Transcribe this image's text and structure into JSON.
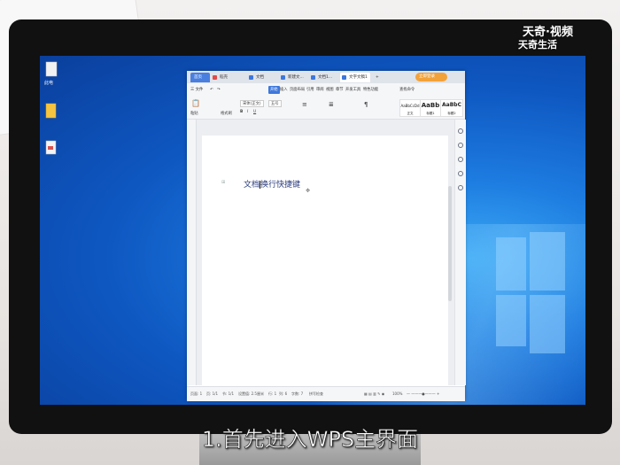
{
  "watermark": {
    "line1": "天奇·视频",
    "line2": "天奇生活"
  },
  "caption": "1.首先进入WPS主界面",
  "desktop": {
    "icons": [
      {
        "name": "file-icon",
        "label": "此电"
      },
      {
        "name": "folder-icon",
        "label": ""
      },
      {
        "name": "doc-icon",
        "label": ""
      }
    ]
  },
  "wps": {
    "tabs": [
      {
        "label": "首页",
        "color": "#4a7fe0"
      },
      {
        "label": "稻壳",
        "color": "#e04a4a"
      },
      {
        "label": "文档",
        "color": "#3d77dd"
      },
      {
        "label": "新建文...",
        "color": "#3d77dd"
      },
      {
        "label": "文档1...",
        "color": "#3d77dd"
      },
      {
        "label": "文字文稿1",
        "color": "#3d77dd"
      }
    ],
    "add_tab": "+",
    "login_label": "立即登录",
    "menu": {
      "file": "三 文件",
      "items": [
        "开始",
        "插入",
        "页面布局",
        "引用",
        "审阅",
        "视图",
        "章节",
        "开发工具",
        "特色功能"
      ],
      "active": "开始",
      "search": "查找命令"
    },
    "toolbar": {
      "paste": "粘贴",
      "format_brush": "格式刷",
      "font_name": "宋体(正文)",
      "font_size": "五号",
      "bold": "B",
      "italic": "I",
      "underline": "U",
      "styles": [
        {
          "sample": "AaBbCcDd",
          "label": "正文"
        },
        {
          "sample": "AaBb",
          "label": "标题1"
        },
        {
          "sample": "AaBbC",
          "label": "标题2"
        }
      ]
    },
    "document": {
      "text_before": "文档",
      "text_after": "换行快捷键"
    },
    "statusbar": {
      "page": "页面: 1",
      "pages": "页: 1/1",
      "section": "节: 1/1",
      "setting": "设置值: 2.5厘米",
      "row": "行: 1",
      "col": "列: 6",
      "words": "字数: 7",
      "spell": "拼写检查",
      "zoom": "100%"
    }
  }
}
